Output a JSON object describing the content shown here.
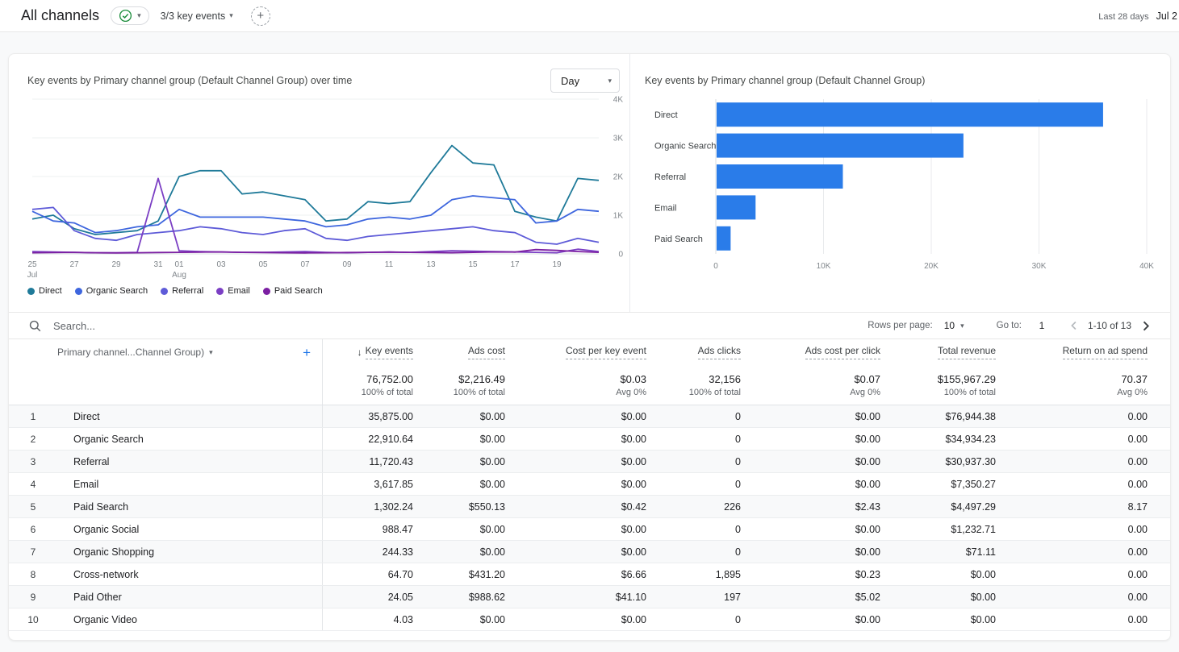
{
  "header": {
    "title": "All channels",
    "key_events_label": "3/3 key events",
    "date_range_label": "Last 28 days",
    "date_range_value": "Jul 2"
  },
  "line_panel": {
    "title": "Key events by Primary channel group (Default Channel Group) over time",
    "granularity": "Day"
  },
  "bar_panel": {
    "title": "Key events by Primary channel group (Default Channel Group)"
  },
  "chart_data": [
    {
      "type": "line",
      "title": "Key events by Primary channel group (Default Channel Group) over time",
      "granularity": "Day",
      "x": [
        "Jul 25",
        "Jul 26",
        "Jul 27",
        "Jul 28",
        "Jul 29",
        "Jul 30",
        "Jul 31",
        "Aug 1",
        "Aug 2",
        "Aug 3",
        "Aug 4",
        "Aug 5",
        "Aug 6",
        "Aug 7",
        "Aug 8",
        "Aug 9",
        "Aug 10",
        "Aug 11",
        "Aug 12",
        "Aug 13",
        "Aug 14",
        "Aug 15",
        "Aug 16",
        "Aug 17",
        "Aug 18",
        "Aug 19",
        "Aug 20",
        "Aug 21"
      ],
      "x_ticks": [
        {
          "i": 0,
          "l": "25",
          "s": "Jul"
        },
        {
          "i": 2,
          "l": "27"
        },
        {
          "i": 4,
          "l": "29"
        },
        {
          "i": 6,
          "l": "31"
        },
        {
          "i": 7,
          "l": "01",
          "s": "Aug"
        },
        {
          "i": 9,
          "l": "03"
        },
        {
          "i": 11,
          "l": "05"
        },
        {
          "i": 13,
          "l": "07"
        },
        {
          "i": 15,
          "l": "09"
        },
        {
          "i": 17,
          "l": "11"
        },
        {
          "i": 19,
          "l": "13"
        },
        {
          "i": 21,
          "l": "15"
        },
        {
          "i": 23,
          "l": "17"
        },
        {
          "i": 25,
          "l": "19"
        }
      ],
      "ylim": [
        0,
        4000
      ],
      "y_ticks": [
        "0",
        "1K",
        "2K",
        "3K",
        "4K"
      ],
      "grid": true,
      "legend_position": "bottom",
      "series": [
        {
          "name": "Direct",
          "color": "#1F7A99",
          "values": [
            900,
            1000,
            650,
            500,
            550,
            600,
            850,
            2000,
            2150,
            2150,
            1550,
            1600,
            1500,
            1400,
            850,
            900,
            1350,
            1300,
            1350,
            2100,
            2800,
            2350,
            2300,
            1100,
            950,
            850,
            1950,
            1900
          ]
        },
        {
          "name": "Organic Search",
          "color": "#3E66DE",
          "values": [
            1100,
            850,
            800,
            550,
            600,
            700,
            750,
            1150,
            950,
            950,
            950,
            950,
            900,
            850,
            700,
            750,
            900,
            950,
            900,
            1000,
            1400,
            1500,
            1450,
            1400,
            800,
            850,
            1150,
            1100
          ]
        },
        {
          "name": "Referral",
          "color": "#5E5BD8",
          "values": [
            1150,
            1200,
            600,
            400,
            350,
            500,
            550,
            600,
            700,
            650,
            550,
            500,
            600,
            650,
            400,
            350,
            450,
            500,
            550,
            600,
            650,
            700,
            600,
            550,
            300,
            250,
            400,
            300
          ]
        },
        {
          "name": "Email",
          "color": "#7B3FC4",
          "values": [
            60,
            50,
            40,
            30,
            30,
            40,
            1950,
            80,
            60,
            50,
            40,
            40,
            50,
            60,
            40,
            30,
            40,
            50,
            40,
            60,
            80,
            70,
            60,
            50,
            40,
            30,
            120,
            60
          ]
        },
        {
          "name": "Paid Search",
          "color": "#7B1FA2",
          "values": [
            30,
            35,
            40,
            30,
            25,
            30,
            35,
            40,
            45,
            50,
            40,
            35,
            30,
            25,
            30,
            35,
            40,
            45,
            40,
            35,
            30,
            40,
            50,
            45,
            110,
            90,
            60,
            40
          ]
        }
      ]
    },
    {
      "type": "bar",
      "title": "Key events by Primary channel group (Default Channel Group)",
      "orientation": "horizontal",
      "categories": [
        "Direct",
        "Organic Search",
        "Referral",
        "Email",
        "Paid Search"
      ],
      "values": [
        35875,
        22911,
        11720,
        3618,
        1302
      ],
      "color": "#2A7CE9",
      "xlim": [
        0,
        40000
      ],
      "x_ticks": [
        "0",
        "10K",
        "20K",
        "30K",
        "40K"
      ],
      "grid": true
    }
  ],
  "toolbar": {
    "search_placeholder": "Search...",
    "rows_per_page_label": "Rows per page:",
    "rows_per_page_value": "10",
    "goto_label": "Go to:",
    "goto_value": "1",
    "pagination": "1-10 of 13"
  },
  "table": {
    "dimension_header": "Primary channel...Channel Group)",
    "sorted_column": "Key events",
    "columns": [
      "Key events",
      "Ads cost",
      "Cost per key event",
      "Ads clicks",
      "Ads cost per click",
      "Total revenue",
      "Return on ad spend"
    ],
    "totals": {
      "values": [
        "76,752.00",
        "$2,216.49",
        "$0.03",
        "32,156",
        "$0.07",
        "$155,967.29",
        "70.37"
      ],
      "subs": [
        "100% of total",
        "100% of total",
        "Avg 0%",
        "100% of total",
        "Avg 0%",
        "100% of total",
        "Avg 0%"
      ]
    },
    "rows": [
      {
        "n": "1",
        "channel": "Direct",
        "values": [
          "35,875.00",
          "$0.00",
          "$0.00",
          "0",
          "$0.00",
          "$76,944.38",
          "0.00"
        ]
      },
      {
        "n": "2",
        "channel": "Organic Search",
        "values": [
          "22,910.64",
          "$0.00",
          "$0.00",
          "0",
          "$0.00",
          "$34,934.23",
          "0.00"
        ]
      },
      {
        "n": "3",
        "channel": "Referral",
        "values": [
          "11,720.43",
          "$0.00",
          "$0.00",
          "0",
          "$0.00",
          "$30,937.30",
          "0.00"
        ]
      },
      {
        "n": "4",
        "channel": "Email",
        "values": [
          "3,617.85",
          "$0.00",
          "$0.00",
          "0",
          "$0.00",
          "$7,350.27",
          "0.00"
        ]
      },
      {
        "n": "5",
        "channel": "Paid Search",
        "values": [
          "1,302.24",
          "$550.13",
          "$0.42",
          "226",
          "$2.43",
          "$4,497.29",
          "8.17"
        ]
      },
      {
        "n": "6",
        "channel": "Organic Social",
        "values": [
          "988.47",
          "$0.00",
          "$0.00",
          "0",
          "$0.00",
          "$1,232.71",
          "0.00"
        ]
      },
      {
        "n": "7",
        "channel": "Organic Shopping",
        "values": [
          "244.33",
          "$0.00",
          "$0.00",
          "0",
          "$0.00",
          "$71.11",
          "0.00"
        ]
      },
      {
        "n": "8",
        "channel": "Cross-network",
        "values": [
          "64.70",
          "$431.20",
          "$6.66",
          "1,895",
          "$0.23",
          "$0.00",
          "0.00"
        ]
      },
      {
        "n": "9",
        "channel": "Paid Other",
        "values": [
          "24.05",
          "$988.62",
          "$41.10",
          "197",
          "$5.02",
          "$0.00",
          "0.00"
        ]
      },
      {
        "n": "10",
        "channel": "Organic Video",
        "values": [
          "4.03",
          "$0.00",
          "$0.00",
          "0",
          "$0.00",
          "$0.00",
          "0.00"
        ]
      }
    ]
  }
}
